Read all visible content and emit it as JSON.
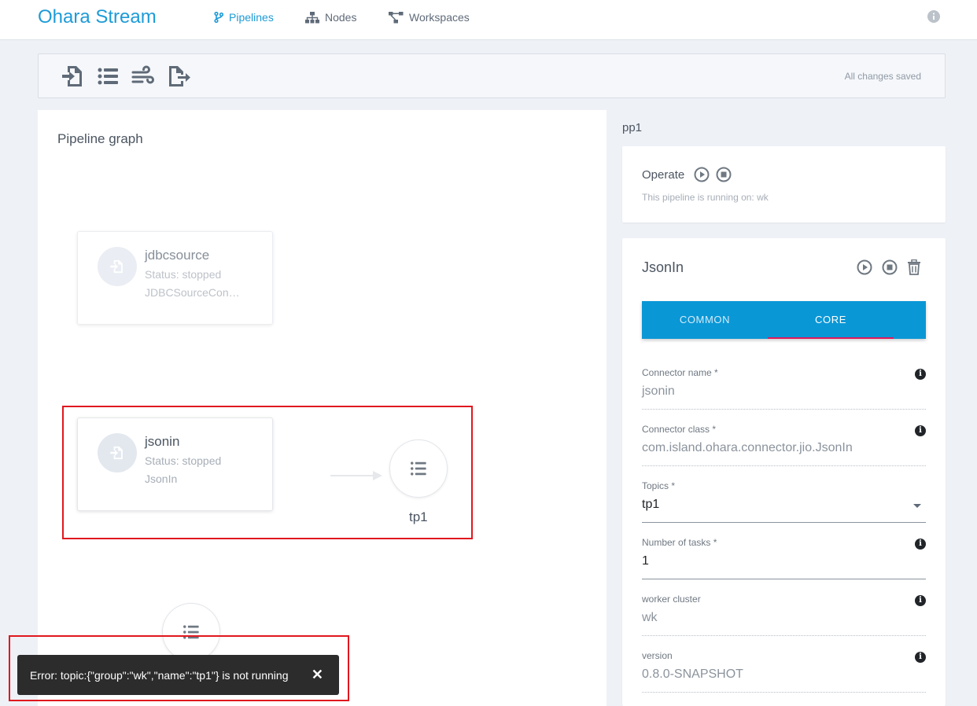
{
  "header": {
    "brand": "Ohara Stream",
    "nav": [
      {
        "label": "Pipelines",
        "icon": "git-branch-icon",
        "active": true
      },
      {
        "label": "Nodes",
        "icon": "sitemap-icon",
        "active": false
      },
      {
        "label": "Workspaces",
        "icon": "project-diagram-icon",
        "active": false
      }
    ],
    "help_icon": "info-circle-icon"
  },
  "toolbar": {
    "tools": [
      {
        "icon": "file-import-icon"
      },
      {
        "icon": "list-icon"
      },
      {
        "icon": "wind-icon"
      },
      {
        "icon": "file-export-icon"
      }
    ],
    "status": "All changes saved"
  },
  "graph": {
    "title": "Pipeline graph",
    "nodes": [
      {
        "name": "jdbcsource",
        "status": "Status: stopped",
        "class": "JDBCSourceCon…",
        "icon": "file-import-icon"
      },
      {
        "name": "jsonin",
        "status": "Status: stopped",
        "class": "JsonIn",
        "icon": "file-import-icon"
      }
    ],
    "topics": [
      {
        "name": "tp1",
        "icon": "list-icon"
      },
      {
        "name": "",
        "icon": "list-icon"
      }
    ]
  },
  "snackbar": {
    "message": "Error: topic:{\"group\":\"wk\",\"name\":\"tp1\"} is not running",
    "close": "✕"
  },
  "sidebar": {
    "pipeline_name": "pp1",
    "operate": {
      "title": "Operate",
      "running_text": "This pipeline is running on: wk",
      "buttons": [
        "play-circle-icon",
        "stop-circle-icon"
      ]
    },
    "connector": {
      "title": "JsonIn",
      "buttons": [
        "play-circle-icon",
        "stop-circle-icon",
        "trash-icon"
      ],
      "tabs": [
        "COMMON",
        "CORE"
      ],
      "active_tab": "CORE",
      "fields": [
        {
          "label": "Connector name *",
          "value": "jsonin",
          "info": true,
          "editable": false
        },
        {
          "label": "Connector class *",
          "value": "com.island.ohara.connector.jio.JsonIn",
          "info": true,
          "editable": false
        },
        {
          "label": "Topics *",
          "value": "tp1",
          "info": false,
          "editable": true,
          "dropdown": true
        },
        {
          "label": "Number of tasks *",
          "value": "1",
          "info": true,
          "editable": true
        },
        {
          "label": "worker cluster",
          "value": "wk",
          "info": true,
          "editable": false
        },
        {
          "label": "version",
          "value": "0.8.0-SNAPSHOT",
          "info": true,
          "editable": false
        }
      ]
    }
  },
  "colors": {
    "brand": "#1d9bd7",
    "tab_bar": "#0a97d6",
    "tab_indicator": "#e0185a",
    "highlight": "#e0181e",
    "snackbar": "#2c2c2c"
  }
}
